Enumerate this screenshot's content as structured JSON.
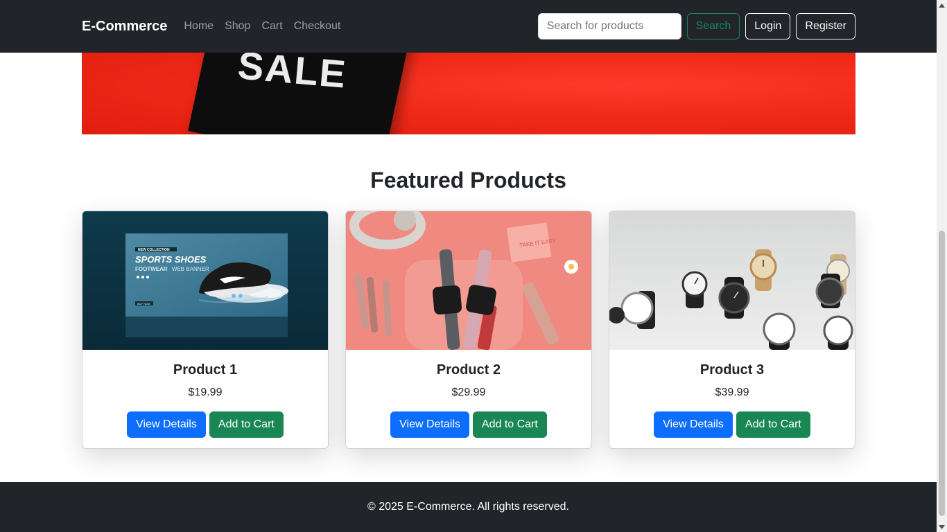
{
  "navbar": {
    "brand": "E-Commerce",
    "links": [
      "Home",
      "Shop",
      "Cart",
      "Checkout"
    ],
    "search_placeholder": "Search for products",
    "search_button": "Search",
    "login_button": "Login",
    "register_button": "Register"
  },
  "hero": {
    "sale_text": "SALE"
  },
  "section": {
    "title": "Featured Products"
  },
  "products": [
    {
      "name": "Product 1",
      "price": "$19.99",
      "view_label": "View Details",
      "cart_label": "Add to Cart",
      "image": "sports-shoes-banner"
    },
    {
      "name": "Product 2",
      "price": "$29.99",
      "view_label": "View Details",
      "cart_label": "Add to Cart",
      "image": "smartwatches-pink-flatlay"
    },
    {
      "name": "Product 3",
      "price": "$39.99",
      "view_label": "View Details",
      "cart_label": "Add to Cart",
      "image": "wrist-watches-collection"
    }
  ],
  "product_image_text": {
    "badge": "NEW COLLECTION",
    "headline": "SPORTS SHOES",
    "subhead": "FOOTWEAR",
    "subhead_suffix": "WEB BANNER",
    "buy": "BUY NOW",
    "box_label": "TAKE IT EASY"
  },
  "footer": {
    "copyright": "© 2025 E-Commerce. All rights reserved."
  },
  "colors": {
    "navbar_bg": "#212529",
    "primary": "#0d6efd",
    "success": "#198754",
    "hero_red": "#f02a18"
  }
}
